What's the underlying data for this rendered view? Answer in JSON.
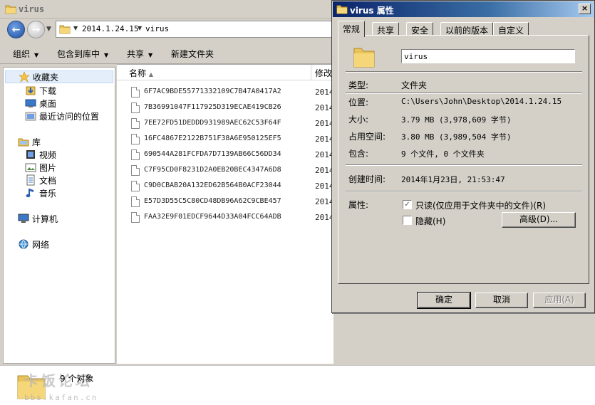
{
  "explorer": {
    "window_title": "virus",
    "address": {
      "crumb_1": "2014.1.24.15",
      "crumb_2": "virus"
    },
    "toolbar": {
      "organize": "组织",
      "include_in_library": "包含到库中",
      "share": "共享",
      "new_folder": "新建文件夹"
    },
    "nav": {
      "favorites": "收藏夹",
      "downloads": "下载",
      "desktop": "桌面",
      "recent": "最近访问的位置",
      "libraries": "库",
      "videos": "视频",
      "pictures": "图片",
      "documents": "文档",
      "music": "音乐",
      "computer": "计算机",
      "network": "网络"
    },
    "columns": {
      "name": "名称",
      "modified": "修改"
    },
    "files": [
      {
        "name": "6F7AC9BDE55771332109C7B47A0417A2",
        "date": "2014"
      },
      {
        "name": "7B36991047F117925D319ECAE419CB26",
        "date": "2014"
      },
      {
        "name": "7EE72FD51DEDDD931989AEC62C53F64F",
        "date": "2014"
      },
      {
        "name": "16FC4867E2122B751F38A6E950125EF5",
        "date": "2014"
      },
      {
        "name": "690544A281FCFDA7D7139AB66C56DD34",
        "date": "2014"
      },
      {
        "name": "C7F95CD0F8231D2A0EB20BEC4347A6D8",
        "date": "2014"
      },
      {
        "name": "C9D0CBAB20A132ED62B564B0ACF23044",
        "date": "2014"
      },
      {
        "name": "E57D3D55C5C80CD48DB96A62C9CBE457",
        "date": "2014"
      },
      {
        "name": "FAA32E9F01EDCF9644D33A04FCC64ADB",
        "date": "2014"
      }
    ],
    "status": {
      "count": "9",
      "count_label": "个对象"
    },
    "watermark": {
      "text": "卡饭论坛",
      "url": "bbs.kafan.cn"
    }
  },
  "properties": {
    "title": "virus 属性",
    "close": "×",
    "tabs": [
      "常规",
      "共享",
      "安全",
      "以前的版本",
      "自定义"
    ],
    "name_value": "virus",
    "type_label": "类型:",
    "type_value": "文件夹",
    "location_label": "位置:",
    "location_value": "C:\\Users\\John\\Desktop\\2014.1.24.15",
    "size_label": "大小:",
    "size_value": "3.79 MB (3,978,609 字节)",
    "size_on_disk_label": "占用空间:",
    "size_on_disk_value": "3.80 MB (3,989,504 字节)",
    "contains_label": "包含:",
    "contains_value": "9 个文件, 0 个文件夹",
    "created_label": "创建时间:",
    "created_value": "2014年1月23日, 21:53:47",
    "attributes_label": "属性:",
    "readonly_label": "只读(仅应用于文件夹中的文件)(R)",
    "readonly_checked": "✓",
    "hidden_label": "隐藏(H)",
    "advanced_button": "高级(D)...",
    "ok_button": "确定",
    "cancel_button": "取消",
    "apply_button": "应用(A)"
  }
}
